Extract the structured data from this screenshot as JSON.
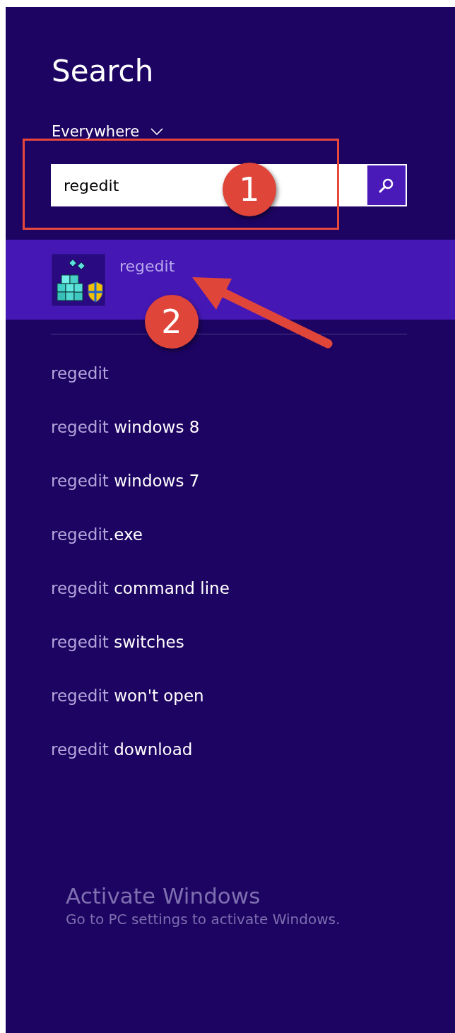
{
  "title": "Search",
  "scope": {
    "label": "Everywhere"
  },
  "search": {
    "value": "regedit"
  },
  "results": [
    {
      "label": "regedit",
      "selected": true
    }
  ],
  "suggestions": [
    {
      "query": "regedit"
    },
    {
      "query": "regedit",
      "completion": " windows 8"
    },
    {
      "query": "regedit",
      "completion": " windows 7"
    },
    {
      "query": "regedit",
      "completion": ".exe"
    },
    {
      "query": "regedit",
      "completion": " command line"
    },
    {
      "query": "regedit",
      "completion": " switches"
    },
    {
      "query": "regedit",
      "completion": " won't open"
    },
    {
      "query": "regedit",
      "completion": " download"
    }
  ],
  "notice": {
    "title": "Activate Windows",
    "text": "Go to PC settings to activate Windows."
  },
  "annotations": [
    {
      "kind": "box"
    },
    {
      "kind": "marker",
      "label": "1"
    },
    {
      "kind": "marker",
      "label": "2"
    },
    {
      "kind": "arrow"
    }
  ]
}
